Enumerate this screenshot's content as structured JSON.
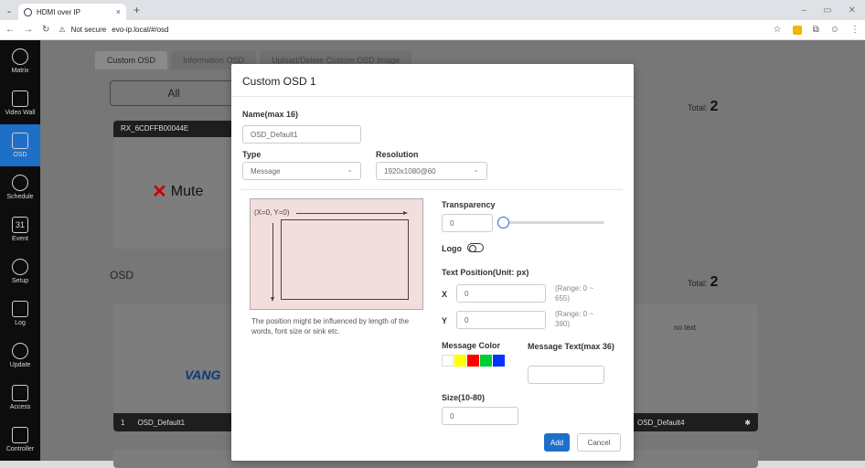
{
  "browser": {
    "tab_title": "HDMI over IP",
    "address": "evo-ip.local/#/osd",
    "security_label": "Not secure"
  },
  "sidebar": {
    "items": [
      {
        "label": "Matrix",
        "icon": "matrix-icon"
      },
      {
        "label": "Video Wall",
        "icon": "video-wall-icon"
      },
      {
        "label": "OSD",
        "icon": "osd-icon",
        "active": true
      },
      {
        "label": "Schedule",
        "icon": "clock-icon"
      },
      {
        "label": "Event",
        "icon": "calendar-icon",
        "icon_text": "31"
      },
      {
        "label": "Setup",
        "icon": "gear-icon"
      },
      {
        "label": "Log",
        "icon": "folder-icon"
      },
      {
        "label": "Update",
        "icon": "upload-icon"
      },
      {
        "label": "Access",
        "icon": "lock-icon"
      },
      {
        "label": "Controller",
        "icon": "controller-icon"
      }
    ]
  },
  "content": {
    "tabs": [
      "Custom OSD",
      "Information OSD",
      "Upload/Delete Custom OSD Image"
    ],
    "filter_all": "All",
    "total_label": "Total:",
    "total_top": "2",
    "total_osd": "2",
    "rx_card": {
      "title": "RX_6CDFFB00044E",
      "mute_label": "Mute"
    },
    "osd_section": "OSD",
    "osd_card": {
      "index": "1",
      "name": "OSD_Default1",
      "logo_text": "VANG"
    },
    "osd_card_right": {
      "no_text": "no text",
      "name": "OSD_Default4"
    }
  },
  "modal": {
    "title": "Custom OSD 1",
    "name_label": "Name(max 16)",
    "name_value": "OSD_Default1",
    "type_label": "Type",
    "type_value": "Message",
    "resolution_label": "Resolution",
    "resolution_value": "1920x1080@60",
    "preview_origin": "(X=0, Y=0)",
    "preview_note": "The position might be influenced by length of the words, font size or sink etc.",
    "transparency_label": "Transparency",
    "transparency_value": "0",
    "logo_label": "Logo",
    "text_pos_label": "Text Position(Unit: px)",
    "x_label": "X",
    "x_value": "0",
    "x_range": "(Range: 0 ~ 655)",
    "y_label": "Y",
    "y_value": "0",
    "y_range": "(Range: 0 ~ 390)",
    "msg_color_label": "Message Color",
    "msg_text_label": "Message Text(max 36)",
    "msg_text_value": "",
    "size_label": "Size(10-80)",
    "size_value": "0",
    "add_label": "Add",
    "cancel_label": "Cancel",
    "colors": [
      "#ffffff",
      "#ffff00",
      "#ff0000",
      "#00cc33",
      "#0033ff"
    ]
  }
}
